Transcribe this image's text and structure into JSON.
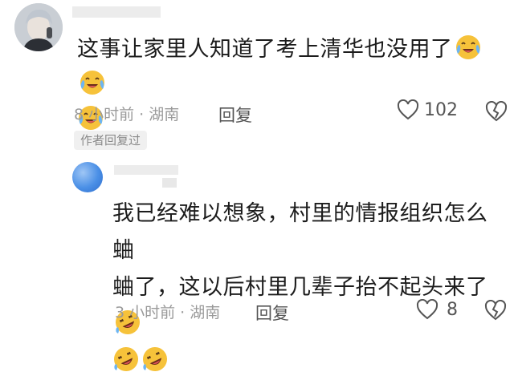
{
  "comments": [
    {
      "text": "这事让家里人知道了考上清华也没用了",
      "emoji_count": 3,
      "time_location": "8 小时前 · 湖南",
      "reply_label": "回复",
      "like_count": "102",
      "author_replied_tag": "作者回复过"
    },
    {
      "text_line1": "我已经难以想象，村里的情报组织怎么蛐",
      "text_line2": "蛐了，这以后村里几辈子抬不起头来了",
      "time_location": "3 小时前 · 湖南",
      "reply_label": "回复",
      "like_count": "8"
    }
  ],
  "icons": {
    "crying_laughing_emoji": "crying-laughing-face-emoji",
    "rofl_emoji": "rolling-on-floor-laughing-emoji",
    "like": "heart-outline-icon",
    "dislike": "broken-heart-outline-icon"
  },
  "colors": {
    "text": "#1c1c1c",
    "meta": "#9a9a9a",
    "emoji_face": "#f6c23a"
  }
}
